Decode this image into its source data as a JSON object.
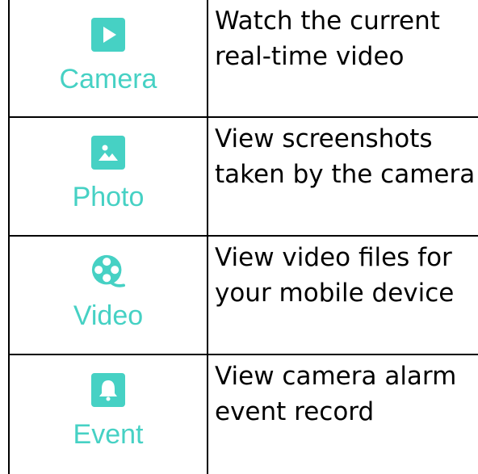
{
  "accent_color": "#46d1c4",
  "rows": [
    {
      "icon": "play-icon",
      "label": "Camera",
      "description_line1": "Watch the current",
      "description_line2": "real-time video"
    },
    {
      "icon": "image-icon",
      "label": "Photo",
      "description_line1": "View screenshots",
      "description_line2": "taken by the camera"
    },
    {
      "icon": "film-reel-icon",
      "label": "Video",
      "description_line1": "View video files for",
      "description_line2": "your mobile device"
    },
    {
      "icon": "bell-icon",
      "label": "Event",
      "description_line1": "View camera alarm",
      "description_line2": "event record"
    }
  ]
}
